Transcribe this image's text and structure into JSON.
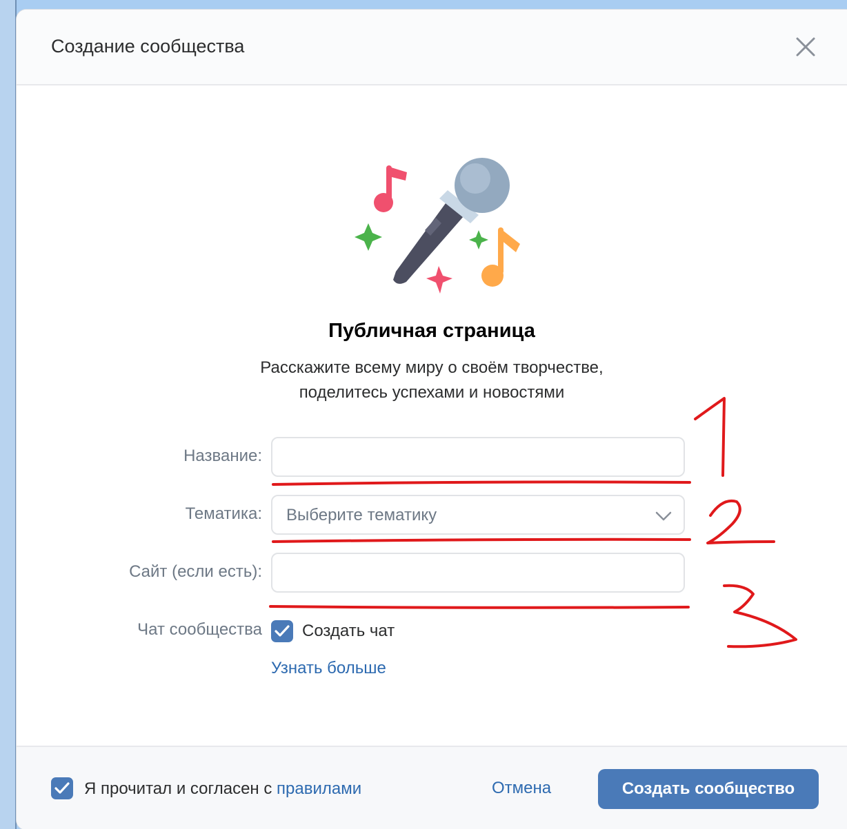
{
  "dialog": {
    "title": "Создание сообщества"
  },
  "hero": {
    "illustration": "microphone-with-music-notes-icon",
    "title": "Публичная страница",
    "description_line1": "Расскажите всему миру о своём творчестве,",
    "description_line2": "поделитесь успехами и новостями"
  },
  "form": {
    "name_label": "Название:",
    "name_value": "",
    "topic_label": "Тематика:",
    "topic_placeholder": "Выберите тематику",
    "site_label": "Сайт (если есть):",
    "site_value": "",
    "chat_label": "Чат сообщества",
    "chat_checkbox_label": "Создать чат",
    "chat_checked": true,
    "learn_more": "Узнать больше"
  },
  "footer": {
    "agree_checked": true,
    "agree_text": "Я прочитал и согласен с ",
    "rules_link": "правилами",
    "cancel_label": "Отмена",
    "create_label": "Создать сообщество"
  },
  "annotations": {
    "mark1": "1",
    "mark2": "2",
    "mark3": "3",
    "color": "#e0191b"
  },
  "colors": {
    "accent": "#4a7ab8",
    "link": "#2d6ab0",
    "background": "#a9cdf2"
  }
}
